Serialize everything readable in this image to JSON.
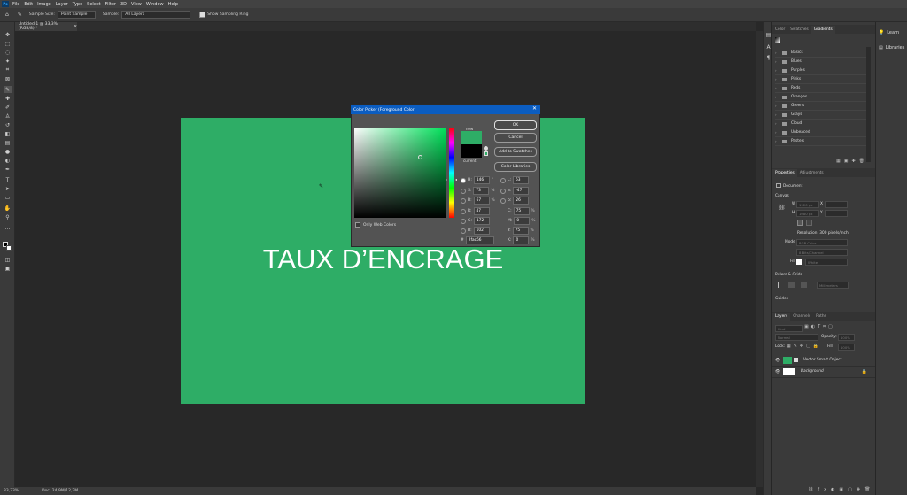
{
  "menu": {
    "logo": "Ps",
    "items": [
      "File",
      "Edit",
      "Image",
      "Layer",
      "Type",
      "Select",
      "Filter",
      "3D",
      "View",
      "Window",
      "Help"
    ]
  },
  "options": {
    "sample_size_label": "Sample Size:",
    "sample_size_value": "Point Sample",
    "sample_label": "Sample:",
    "sample_value": "All Layers",
    "show_ring_label": "Show Sampling Ring"
  },
  "document": {
    "tab_title": "Untitled-1 @ 33,3% (RGB/8) *",
    "canvas_color": "#2ead66",
    "big_text": "TAUX D’ENCRAGE"
  },
  "status": {
    "zoom": "33,33%",
    "doc": "Doc: 24,9M/12,2M"
  },
  "color_picker": {
    "title": "Color Picker (Foreground Color)",
    "close": "✕",
    "new_label": "new",
    "current_label": "current",
    "buttons": {
      "ok": "OK",
      "cancel": "Cancel",
      "add": "Add to Swatches",
      "libraries": "Color Libraries"
    },
    "hsb": [
      {
        "label": "H:",
        "value": "146",
        "unit": "°"
      },
      {
        "label": "S:",
        "value": "73",
        "unit": "%"
      },
      {
        "label": "B:",
        "value": "67",
        "unit": "%"
      }
    ],
    "rgb": [
      {
        "label": "R:",
        "value": "47"
      },
      {
        "label": "G:",
        "value": "172"
      },
      {
        "label": "B:",
        "value": "102"
      }
    ],
    "lab": [
      {
        "label": "L:",
        "value": "63"
      },
      {
        "label": "a:",
        "value": "-47"
      },
      {
        "label": "b:",
        "value": "26"
      }
    ],
    "cmyk": [
      {
        "label": "C:",
        "value": "75",
        "unit": "%"
      },
      {
        "label": "M:",
        "value": "0",
        "unit": "%"
      },
      {
        "label": "Y:",
        "value": "75",
        "unit": "%"
      },
      {
        "label": "K:",
        "value": "0",
        "unit": "%"
      }
    ],
    "hex_label": "#",
    "hex": "2fac66",
    "only_web": "Only Web Colors",
    "new_color": "#2ead66",
    "current_color": "#000000"
  },
  "swatches_panel": {
    "tabs": [
      "Color",
      "Swatches",
      "Gradients"
    ],
    "groups": [
      "Basics",
      "Blues",
      "Purples",
      "Pinks",
      "Reds",
      "Oranges",
      "Greens",
      "Grays",
      "Cloud",
      "Unbeaced",
      "Pastels"
    ]
  },
  "properties_panel": {
    "tabs": [
      "Properties",
      "Adjustments"
    ],
    "document_label": "Document",
    "canvas_label": "Canvas",
    "w_label": "W",
    "w_value": "1920 px",
    "h_label": "H",
    "h_value": "1080 px",
    "x_label": "X",
    "y_label": "Y",
    "resolution": "Resolution: 300 pixels/inch",
    "mode_label": "Mode",
    "mode_value": "RGB Color",
    "depth_value": "8 Bits/Channel",
    "fill_label": "Fill",
    "fill_value": "White",
    "rulers_label": "Rulers & Grids",
    "rulers_unit": "Millimeters",
    "guides_label": "Guides"
  },
  "layers_panel": {
    "tabs": [
      "Layers",
      "Channels",
      "Paths"
    ],
    "kind": "Kind",
    "blend": "Normal",
    "opacity_label": "Opacity:",
    "opacity_value": "100%",
    "lock_label": "Lock:",
    "fill_label": "Fill:",
    "fill_value": "100%",
    "layers": [
      {
        "name": "Vector Smart Object",
        "thumb": "#2ead66"
      },
      {
        "name": "Background",
        "thumb": "#ffffff"
      }
    ]
  },
  "far_right": {
    "learn": "Learn",
    "libraries": "Libraries"
  }
}
